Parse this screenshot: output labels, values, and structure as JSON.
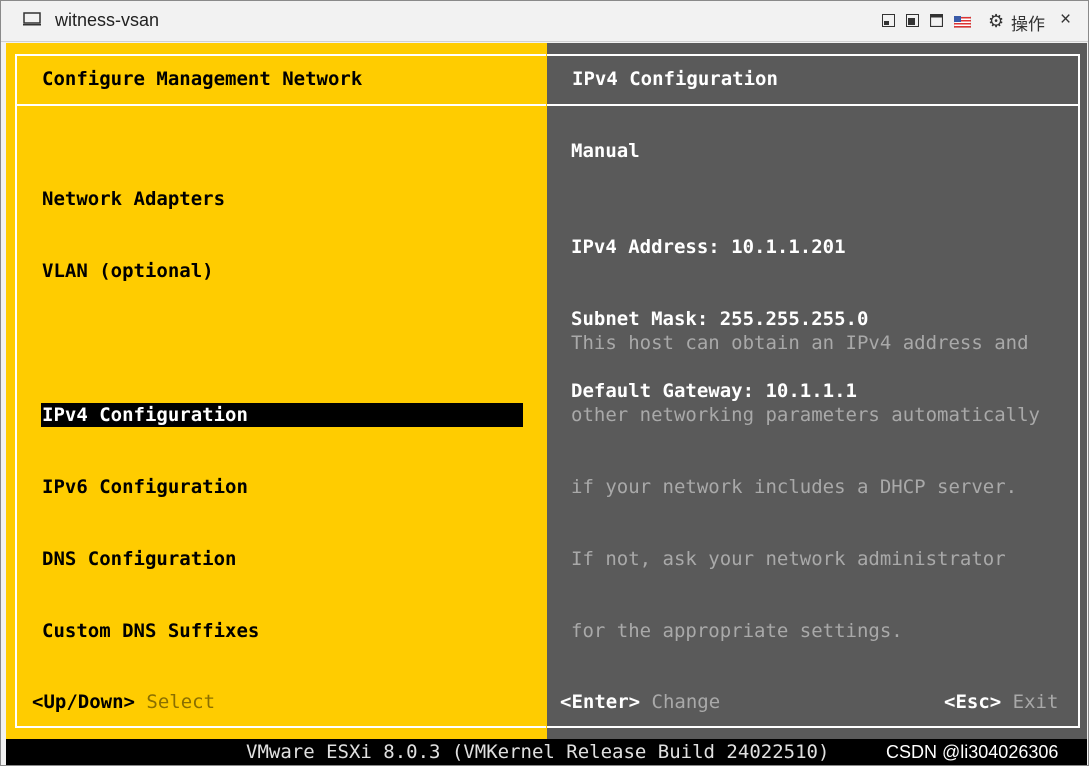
{
  "window": {
    "title": "witness-vsan",
    "actions_label": "操作",
    "close_glyph": "×",
    "icons": [
      "monitor-icon",
      "minimize-icon",
      "restore-icon",
      "maximize-icon",
      "flag-icon",
      "gear-icon"
    ]
  },
  "left_pane": {
    "title": "Configure Management Network",
    "menu": [
      {
        "label": "Network Adapters",
        "selected": false
      },
      {
        "label": "VLAN (optional)",
        "selected": false
      },
      {
        "label": "IPv4 Configuration",
        "selected": true
      },
      {
        "label": "IPv6 Configuration",
        "selected": false
      },
      {
        "label": "DNS Configuration",
        "selected": false
      },
      {
        "label": "Custom DNS Suffixes",
        "selected": false
      }
    ],
    "footer": {
      "key": "<Up/Down>",
      "hint": "Select"
    }
  },
  "right_pane": {
    "title": "IPv4 Configuration",
    "mode": "Manual",
    "details": [
      "IPv4 Address: 10.1.1.201",
      "Subnet Mask: 255.255.255.0",
      "Default Gateway: 10.1.1.1"
    ],
    "help": [
      "This host can obtain an IPv4 address and",
      "other networking parameters automatically",
      "if your network includes a DHCP server.",
      "If not, ask your network administrator",
      "for the appropriate settings."
    ],
    "footer_enter": {
      "key": "<Enter>",
      "hint": "Change"
    },
    "footer_esc": {
      "key": "<Esc>",
      "hint": "Exit"
    }
  },
  "status_bar": "VMware ESXi 8.0.3 (VMKernel Release Build 24022510)",
  "watermark": "CSDN @li304026306",
  "colors": {
    "left_bg": "#ffcc00",
    "right_bg": "#5a5a5a",
    "selected_bg": "#000000",
    "help_text": "#a9a9a9"
  }
}
